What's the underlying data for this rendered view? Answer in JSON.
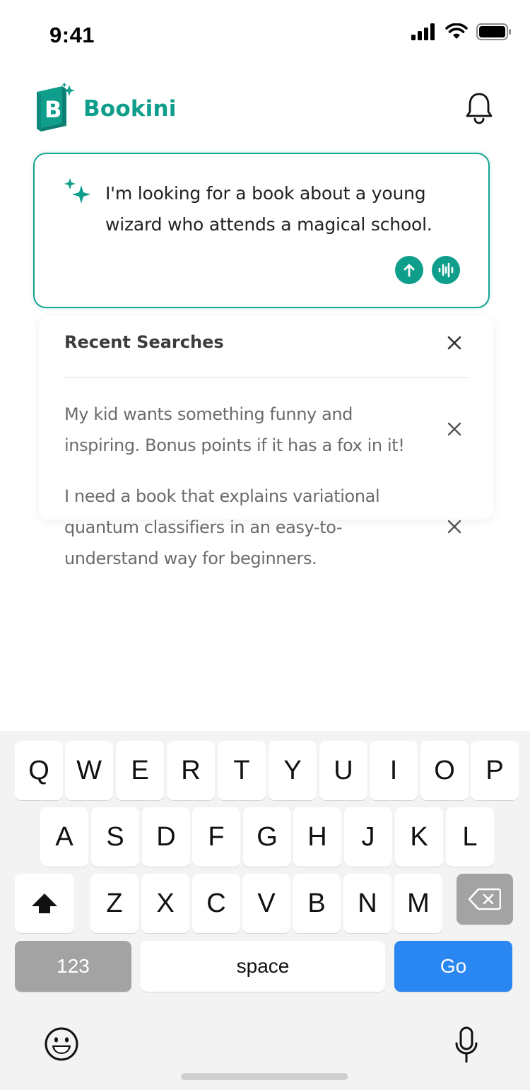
{
  "status_bar": {
    "time": "9:41"
  },
  "header": {
    "app_name": "Bookini"
  },
  "search": {
    "query": "I'm looking for a book about a young wizard who attends a magical school."
  },
  "recent_searches": {
    "title": "Recent Searches",
    "items": [
      {
        "text": "My kid wants something funny and inspiring. Bonus points if it has a fox in it!"
      },
      {
        "text": "I need a book that explains variational quantum classifiers in an easy-to-understand way for beginners."
      }
    ]
  },
  "keyboard": {
    "row1": [
      "Q",
      "W",
      "E",
      "R",
      "T",
      "Y",
      "U",
      "I",
      "O",
      "P"
    ],
    "row2": [
      "A",
      "S",
      "D",
      "F",
      "G",
      "H",
      "J",
      "K",
      "L"
    ],
    "row3": [
      "Z",
      "X",
      "C",
      "V",
      "B",
      "N",
      "M"
    ],
    "numbers_label": "123",
    "space_label": "space",
    "go_label": "Go"
  },
  "colors": {
    "brand": "#0f9e8c",
    "go_key": "#2a86f0",
    "keyboard_bg": "#f3f3f3"
  },
  "icons": {
    "signal": "cellular-signal-icon",
    "wifi": "wifi-icon",
    "battery": "battery-icon",
    "logo": "book-logo-icon",
    "bell": "bell-icon",
    "sparkle": "sparkle-icon",
    "send": "arrow-up-icon",
    "voice": "audio-wave-icon",
    "close": "close-icon",
    "shift": "shift-icon",
    "backspace": "backspace-icon",
    "emoji": "emoji-icon",
    "mic": "microphone-icon"
  }
}
